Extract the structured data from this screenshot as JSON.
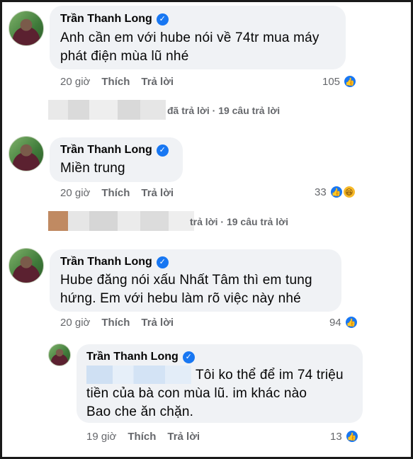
{
  "comments": [
    {
      "author": "Trần Thanh Long",
      "text_lines": [
        "Anh cần em với hube nói về 74tr mua máy",
        "phát điện mùa lũ nhé"
      ],
      "time": "20 giờ",
      "like": "Thích",
      "reply": "Trả lời",
      "reactions": "105",
      "reply_summary": "đã trả lời · 19 câu trả lời"
    },
    {
      "author": "Trần Thanh Long",
      "text_lines": [
        "Miền trung"
      ],
      "time": "20 giờ",
      "like": "Thích",
      "reply": "Trả lời",
      "reactions": "33",
      "reply_summary": "trả lời · 19 câu trả lời"
    },
    {
      "author": "Trần Thanh Long",
      "text_lines": [
        "Hube đăng nói xấu Nhất Tâm thì em tung",
        "hứng.  Em với hebu làm rõ việc này nhé"
      ],
      "time": "20 giờ",
      "like": "Thích",
      "reply": "Trả lời",
      "reactions": "94"
    },
    {
      "author": "Trần Thanh Long",
      "text_lines": [
        "Tôi ko thể để im 74 triệu",
        "tiền của bà con mùa lũ. im khác nào",
        "Bao che ăn chặn."
      ],
      "time": "19 giờ",
      "like": "Thích",
      "reply": "Trả lời",
      "reactions": "13"
    }
  ],
  "colors": {
    "bubble": "#f0f2f5",
    "accent": "#1877f2",
    "meta": "#65676b"
  },
  "icons": [
    "verified-badge-icon",
    "like-reaction-icon",
    "haha-reaction-icon",
    "avatar"
  ]
}
